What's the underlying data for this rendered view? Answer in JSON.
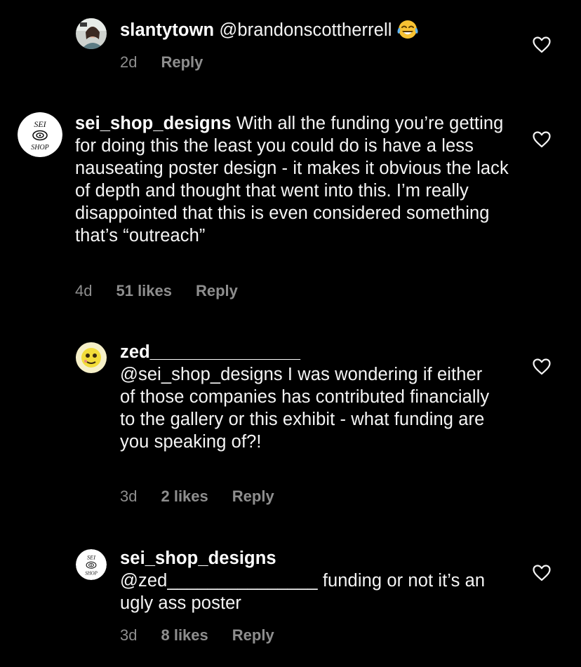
{
  "comments": [
    {
      "username": "slantytown",
      "text": "@brandonscottherrell",
      "emoji_name": "face-with-tears-of-joy-emoji",
      "time": "2d",
      "likes": "",
      "reply_label": "Reply"
    },
    {
      "username": "sei_shop_designs",
      "text": "With all the funding you’re getting for doing this the least you could do is have a less nauseating poster design - it makes it obvious the lack of depth and thought that went into this. I’m really disappointed that this is even considered something that’s “outreach”",
      "time": "4d",
      "likes": "51 likes",
      "reply_label": "Reply"
    },
    {
      "username": "zed_______________",
      "text": "@sei_shop_designs I was wondering if either of those companies has contributed financially to the gallery or this exhibit - what funding are you speaking of?!",
      "time": "3d",
      "likes": "2 likes",
      "reply_label": "Reply"
    },
    {
      "username": "sei_shop_designs",
      "text": "@zed_______________ funding or not it’s an ugly ass poster",
      "time": "3d",
      "likes": "8 likes",
      "reply_label": "Reply"
    }
  ],
  "avatars": {
    "sei_shop_logo_text_top": "SEI",
    "sei_shop_logo_text_bottom": "SHOP"
  },
  "icons": {
    "like": "heart-outline-icon"
  },
  "colors": {
    "background": "#000000",
    "primary_text": "#f5f5f5",
    "secondary_text": "#8e8e8e"
  }
}
